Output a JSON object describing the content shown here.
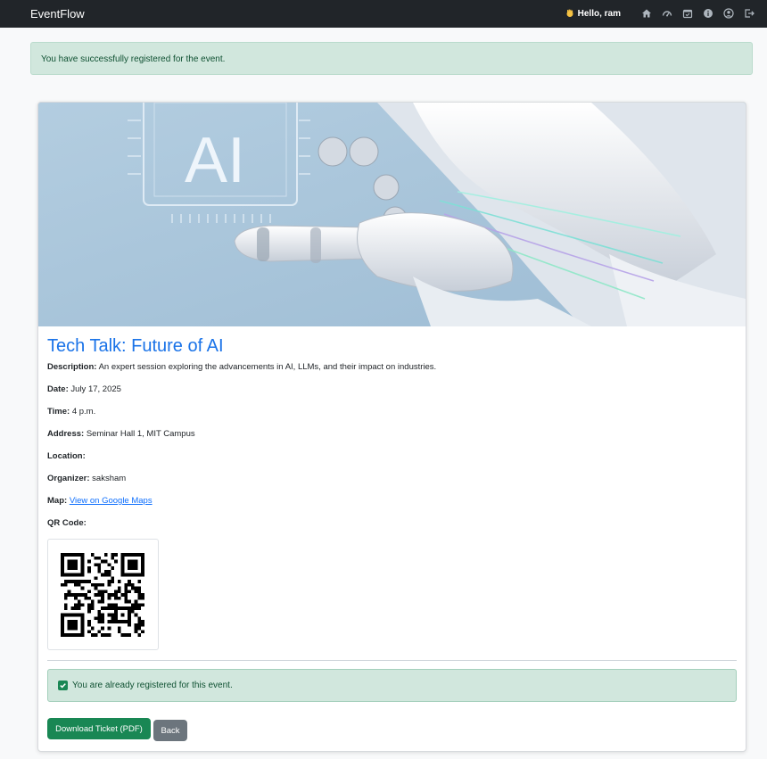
{
  "navbar": {
    "brand": "EventFlow",
    "greeting": "Hello, ram",
    "icons": [
      "home-icon",
      "dashboard-icon",
      "calendar-icon",
      "info-icon",
      "profile-icon",
      "logout-icon"
    ]
  },
  "alerts": {
    "success": "You have successfully registered for the event.",
    "already_registered": "You are already registered for this event."
  },
  "hero": {
    "text": "AI"
  },
  "event": {
    "title": "Tech Talk: Future of AI",
    "description_label": "Description:",
    "description": "An expert session exploring the advancements in AI, LLMs, and their impact on industries.",
    "date_label": "Date:",
    "date": "July 17, 2025",
    "time_label": "Time:",
    "time": "4 p.m.",
    "address_label": "Address:",
    "address": "Seminar Hall 1, MIT Campus",
    "location_label": "Location:",
    "location": "",
    "organizer_label": "Organizer:",
    "organizer": "saksham",
    "map_label": "Map:",
    "map_link": "View on Google Maps",
    "qr_label": "QR Code:"
  },
  "buttons": {
    "download": "Download Ticket (PDF)",
    "back": "Back"
  },
  "colors": {
    "navbar": "#212529",
    "title": "#1a73e8",
    "success_bg": "#d1e7dd",
    "success_text": "#0f5132",
    "download_btn": "#198754",
    "back_btn": "#6c757d"
  }
}
